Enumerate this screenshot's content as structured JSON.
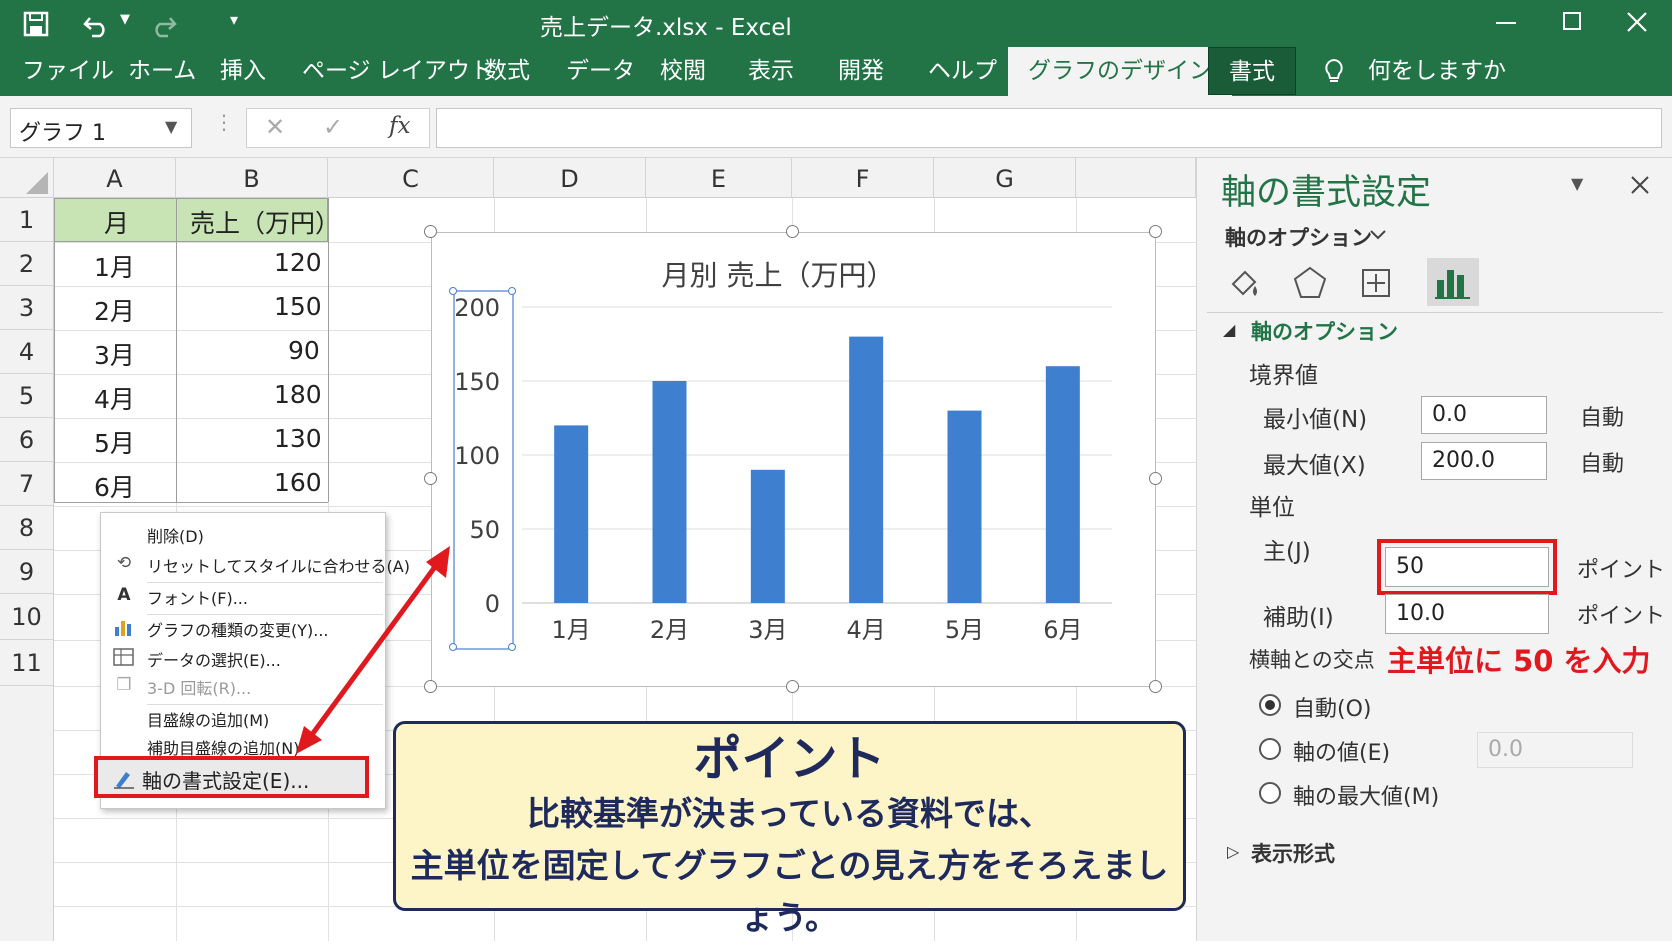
{
  "window": {
    "title": "売上データ.xlsx  -  Excel"
  },
  "ribbon": {
    "tabs": [
      "ファイル",
      "ホーム",
      "挿入",
      "ページ レイアウト",
      "数式",
      "データ",
      "校閲",
      "表示",
      "開発",
      "ヘルプ"
    ],
    "active_tab": "グラフのデザイン",
    "format_tab": "書式",
    "tell_me": "何をしますか"
  },
  "formula_bar": {
    "name_box": "グラフ 1",
    "fx": "fx"
  },
  "sheet": {
    "columns": [
      "A",
      "B",
      "C",
      "D",
      "E",
      "F",
      "G"
    ],
    "rows": [
      "1",
      "2",
      "3",
      "4",
      "5",
      "6",
      "7",
      "8",
      "9",
      "10",
      "11"
    ],
    "header": {
      "a": "月",
      "b": "売上（万円）"
    },
    "data": [
      [
        "1月",
        "120"
      ],
      [
        "2月",
        "150"
      ],
      [
        "3月",
        "90"
      ],
      [
        "4月",
        "180"
      ],
      [
        "5月",
        "130"
      ],
      [
        "6月",
        "160"
      ]
    ]
  },
  "chart_data": {
    "type": "bar",
    "title": "月別 売上（万円）",
    "categories": [
      "1月",
      "2月",
      "3月",
      "4月",
      "5月",
      "6月"
    ],
    "values": [
      120,
      150,
      90,
      180,
      130,
      160
    ],
    "ylim": [
      0,
      200
    ],
    "yticks": [
      "0",
      "50",
      "100",
      "150",
      "200"
    ],
    "bar_color": "#3f7fd0",
    "grid": true
  },
  "context_menu": {
    "items": [
      "削除(D)",
      "リセットしてスタイルに合わせる(A)",
      "フォント(F)...",
      "グラフの種類の変更(Y)...",
      "データの選択(E)...",
      "3-D 回転(R)...",
      "目盛線の追加(M)",
      "補助目盛線の追加(N)",
      "軸の書式設定(E)..."
    ]
  },
  "callout": {
    "title": "ポイント",
    "line1": "比較基準が決まっている資料では、",
    "line2": "主単位を固定してグラフごとの見え方をそろえましょう。"
  },
  "pane": {
    "title": "軸の書式設定",
    "options_dropdown": "軸のオプション",
    "section": "軸のオプション",
    "bounds_label": "境界値",
    "min_label": "最小値(N)",
    "min_value": "0.0",
    "min_auto": "自動",
    "max_label": "最大値(X)",
    "max_value": "200.0",
    "max_auto": "自動",
    "units_label": "単位",
    "major_label": "主(J)",
    "major_value": "50",
    "major_unit": "ポイント",
    "minor_label": "補助(I)",
    "minor_value": "10.0",
    "minor_unit": "ポイント",
    "cross_label": "横軸との交点",
    "annotation": "主単位に 50 を入力",
    "radio_auto": "自動(O)",
    "radio_value": "軸の値(E)",
    "radio_value_input": "0.0",
    "radio_max": "軸の最大値(M)",
    "display_format": "表示形式"
  },
  "colors": {
    "excel_green": "#227447",
    "highlight_red": "#e0191f",
    "callout_bg": "#fdf4c7",
    "callout_text": "#1f2a5c"
  }
}
